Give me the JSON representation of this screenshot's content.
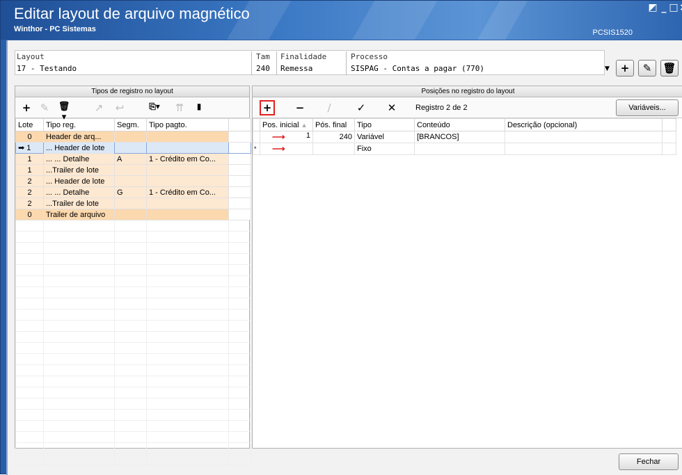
{
  "window": {
    "title": "Editar layout de arquivo magnético",
    "subtitle": "Winthor - PC Sistemas",
    "code": "PCSIS1520"
  },
  "header": {
    "layout_caption": "Layout",
    "layout_value": "17 - Testando",
    "tam_caption": "Tam",
    "tam_value": "240",
    "finalidade_caption": "Finalidade",
    "finalidade_value": "Remessa",
    "processo_caption": "Processo",
    "processo_value": "SISPAG - Contas a pagar (770)"
  },
  "left_panel": {
    "title": "Tipos de registro no layout",
    "columns": [
      "Lote",
      "Tipo reg.",
      "Segm.",
      "Tipo pagto."
    ],
    "rows": [
      {
        "lote": "0",
        "tipo": "Header de arq...",
        "segm": "",
        "pagto": "",
        "style": "hdr"
      },
      {
        "lote": "1",
        "tipo": "... Header de lote",
        "segm": "",
        "pagto": "",
        "style": "sel"
      },
      {
        "lote": "1",
        "tipo": "... ... Detalhe",
        "segm": "A",
        "pagto": "1 - Crédito em Co...",
        "style": "lt"
      },
      {
        "lote": "1",
        "tipo": "...Trailer de lote",
        "segm": "",
        "pagto": "",
        "style": "lt"
      },
      {
        "lote": "2",
        "tipo": "... Header de lote",
        "segm": "",
        "pagto": "",
        "style": "lt"
      },
      {
        "lote": "2",
        "tipo": "... ... Detalhe",
        "segm": "G",
        "pagto": "1 - Crédito em Co...",
        "style": "lt"
      },
      {
        "lote": "2",
        "tipo": "...Trailer de lote",
        "segm": "",
        "pagto": "",
        "style": "lt"
      },
      {
        "lote": "0",
        "tipo": "Trailer de arquivo",
        "segm": "",
        "pagto": "",
        "style": "hdr"
      }
    ]
  },
  "right_panel": {
    "title": "Posições no registro do layout",
    "registro_label": "Registro 2 de 2",
    "variaveis_label": "Variáveis...",
    "columns": [
      "Pos. inicial",
      "Pós. final",
      "Tipo",
      "Conteúdo",
      "Descrição (opcional)"
    ],
    "rows": [
      {
        "marker": "",
        "pos_inicial": "1",
        "pos_final": "240",
        "tipo": "Variável",
        "conteudo": "[BRANCOS]",
        "descricao": ""
      },
      {
        "marker": "*",
        "pos_inicial": "",
        "pos_final": "",
        "tipo": "Fixo",
        "conteudo": "",
        "descricao": ""
      }
    ]
  },
  "footer": {
    "fechar_label": "Fechar"
  },
  "icons": {
    "add": "plus-icon",
    "remove": "minus-icon",
    "confirm": "check-icon",
    "cancel": "x-icon",
    "edit": "pencil-icon",
    "delete": "trash-icon",
    "row_pointer": "arrow-right-icon",
    "accent_red": "#e02020"
  }
}
